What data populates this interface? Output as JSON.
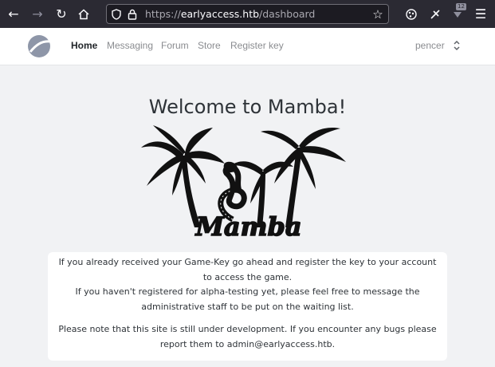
{
  "browser": {
    "url_prefix": "https://",
    "url_host": "earlyaccess.htb",
    "url_path": "/dashboard",
    "notification_count": "12"
  },
  "navbar": {
    "links": [
      {
        "label": "Home",
        "active": true
      },
      {
        "label": "Messaging",
        "active": false
      },
      {
        "label": "Forum",
        "active": false
      },
      {
        "label": "Store",
        "active": false
      },
      {
        "label": "Register key",
        "active": false
      }
    ],
    "username": "pencer"
  },
  "main": {
    "title": "Welcome to Mamba!",
    "logo_text": "Mamba",
    "paragraph1": "If you already received your Game-Key go ahead and register the key to your account to access the game.\nIf you haven't registered for alpha-testing yet, please feel free to message the administrative staff to be put on the waiting list.",
    "paragraph2": "Please note that this site is still under development. If you encounter any bugs please report them to admin@earlyaccess.htb."
  },
  "icons": {
    "back": "arrow-left-icon",
    "forward": "arrow-right-icon",
    "reload": "reload-icon",
    "home": "home-icon",
    "shield": "shield-icon",
    "lock": "lock-icon",
    "bookmark": "star-icon",
    "extensions": "puzzle-icon",
    "menu": "hamburger-menu-icon"
  },
  "colors": {
    "chrome_bg": "#2b2a33",
    "page_bg": "#f1f2f4",
    "nav_active": "#1f2327",
    "nav_muted": "#8a8c90"
  }
}
